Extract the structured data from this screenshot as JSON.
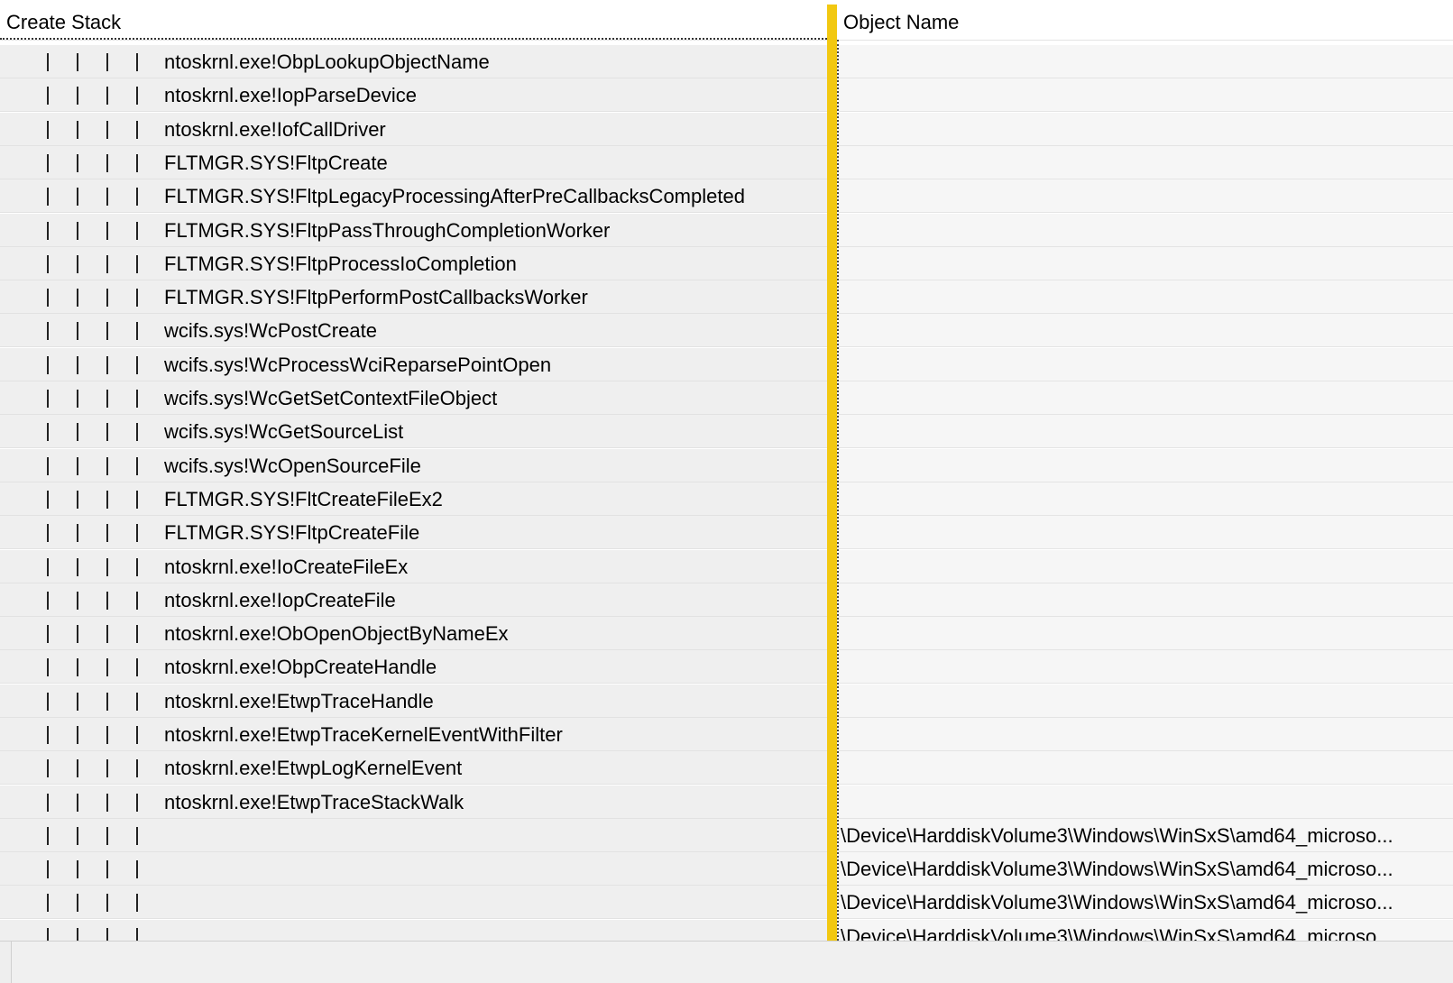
{
  "columns": {
    "stack_header": "Create Stack",
    "object_header": "Object Name"
  },
  "rows": [
    {
      "frame": "ntoskrnl.exe!ObpLookupObjectName",
      "object": ""
    },
    {
      "frame": "ntoskrnl.exe!IopParseDevice",
      "object": ""
    },
    {
      "frame": "ntoskrnl.exe!IofCallDriver",
      "object": ""
    },
    {
      "frame": "FLTMGR.SYS!FltpCreate",
      "object": ""
    },
    {
      "frame": "FLTMGR.SYS!FltpLegacyProcessingAfterPreCallbacksCompleted",
      "object": ""
    },
    {
      "frame": "FLTMGR.SYS!FltpPassThroughCompletionWorker",
      "object": ""
    },
    {
      "frame": "FLTMGR.SYS!FltpProcessIoCompletion",
      "object": ""
    },
    {
      "frame": "FLTMGR.SYS!FltpPerformPostCallbacksWorker",
      "object": ""
    },
    {
      "frame": "wcifs.sys!WcPostCreate",
      "object": ""
    },
    {
      "frame": "wcifs.sys!WcProcessWciReparsePointOpen",
      "object": ""
    },
    {
      "frame": "wcifs.sys!WcGetSetContextFileObject",
      "object": ""
    },
    {
      "frame": "wcifs.sys!WcGetSourceList",
      "object": ""
    },
    {
      "frame": "wcifs.sys!WcOpenSourceFile",
      "object": ""
    },
    {
      "frame": "FLTMGR.SYS!FltCreateFileEx2",
      "object": ""
    },
    {
      "frame": "FLTMGR.SYS!FltpCreateFile",
      "object": ""
    },
    {
      "frame": "ntoskrnl.exe!IoCreateFileEx",
      "object": ""
    },
    {
      "frame": "ntoskrnl.exe!IopCreateFile",
      "object": ""
    },
    {
      "frame": "ntoskrnl.exe!ObOpenObjectByNameEx",
      "object": ""
    },
    {
      "frame": "ntoskrnl.exe!ObpCreateHandle",
      "object": ""
    },
    {
      "frame": "ntoskrnl.exe!EtwpTraceHandle",
      "object": ""
    },
    {
      "frame": "ntoskrnl.exe!EtwpTraceKernelEventWithFilter",
      "object": ""
    },
    {
      "frame": "ntoskrnl.exe!EtwpLogKernelEvent",
      "object": ""
    },
    {
      "frame": "ntoskrnl.exe!EtwpTraceStackWalk",
      "object": ""
    },
    {
      "frame": "",
      "object": "\\Device\\HarddiskVolume3\\Windows\\WinSxS\\amd64_microso..."
    },
    {
      "frame": "",
      "object": "\\Device\\HarddiskVolume3\\Windows\\WinSxS\\amd64_microso..."
    },
    {
      "frame": "",
      "object": "\\Device\\HarddiskVolume3\\Windows\\WinSxS\\amd64_microso..."
    },
    {
      "frame": "",
      "object": "\\Device\\HarddiskVolume3\\Windows\\WinSxS\\amd64_microso..."
    }
  ],
  "colors": {
    "separator": "#f2c811",
    "stack_cell_bg": "#efefef",
    "object_cell_bg": "#f6f6f6"
  }
}
